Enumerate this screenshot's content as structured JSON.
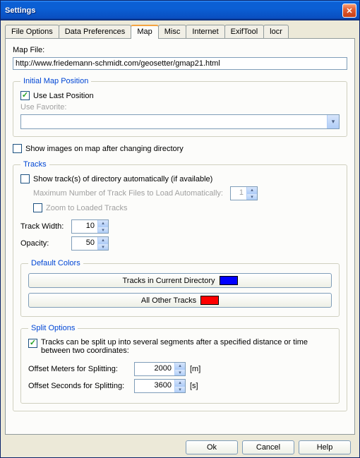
{
  "window": {
    "title": "Settings"
  },
  "tabs": {
    "file_options": "File Options",
    "data_preferences": "Data Preferences",
    "map": "Map",
    "misc": "Misc",
    "internet": "Internet",
    "exiftool": "ExifTool",
    "locr": "locr"
  },
  "map": {
    "map_file_label": "Map File:",
    "map_file_value": "http://www.friedemann-schmidt.com/geosetter/gmap21.html",
    "initial_position": {
      "legend": "Initial Map Position",
      "use_last_label": "Use Last Position",
      "use_favorite_label": "Use Favorite:"
    },
    "show_images_label": "Show images on map after changing directory",
    "tracks": {
      "legend": "Tracks",
      "show_auto_label": "Show track(s) of directory automatically (if available)",
      "max_files_label": "Maximum Number of Track Files to Load Automatically:",
      "max_files_value": "1",
      "zoom_label": "Zoom to Loaded Tracks",
      "width_label": "Track Width:",
      "width_value": "10",
      "opacity_label": "Opacity:",
      "opacity_value": "50",
      "colors": {
        "legend": "Default Colors",
        "current_label": "Tracks in Current Directory",
        "current_color": "#0000ff",
        "other_label": "All Other Tracks",
        "other_color": "#ff0000"
      },
      "split": {
        "legend": "Split Options",
        "enable_label": "Tracks can be split up into several segments after a specified distance or time between two coordinates:",
        "meters_label": "Offset Meters for Splitting:",
        "meters_value": "2000",
        "meters_unit": "[m]",
        "seconds_label": "Offset Seconds for Splitting:",
        "seconds_value": "3600",
        "seconds_unit": "[s]"
      }
    }
  },
  "buttons": {
    "ok": "Ok",
    "cancel": "Cancel",
    "help": "Help"
  }
}
